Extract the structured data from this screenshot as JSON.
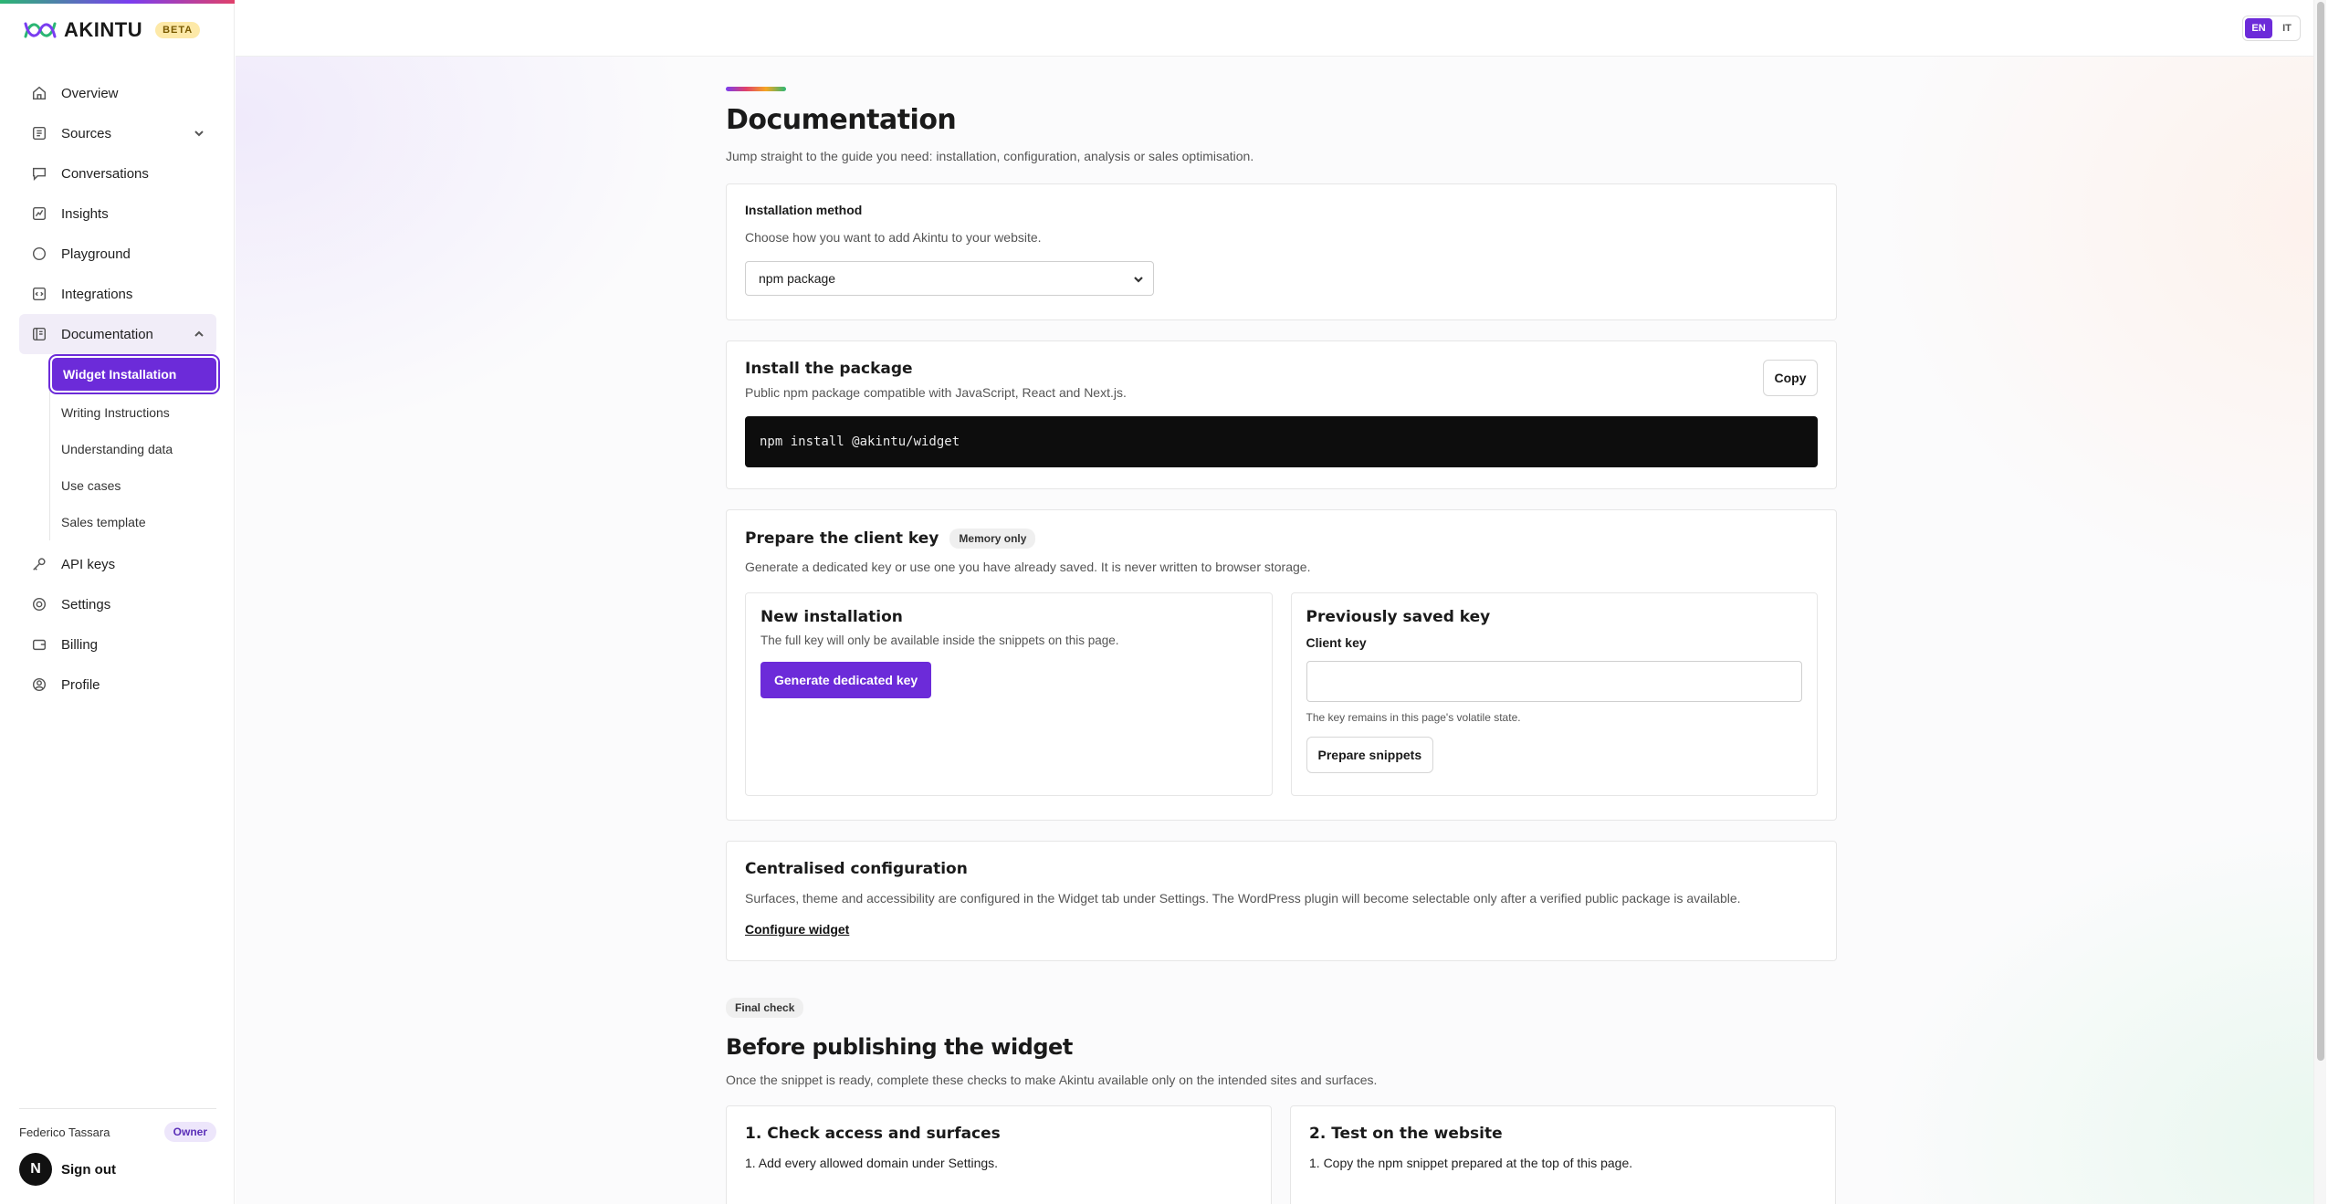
{
  "brand": {
    "name": "AKINTU",
    "badge": "BETA"
  },
  "nav": {
    "overview": "Overview",
    "sources": "Sources",
    "conversations": "Conversations",
    "insights": "Insights",
    "playground": "Playground",
    "integrations": "Integrations",
    "documentation": "Documentation",
    "docs_sub": [
      "Widget Installation",
      "Writing Instructions",
      "Understanding data",
      "Use cases",
      "Sales template"
    ],
    "api_keys": "API keys",
    "settings": "Settings",
    "billing": "Billing",
    "profile": "Profile"
  },
  "user": {
    "name": "Federico Tassara",
    "role": "Owner",
    "avatar_letter": "N",
    "signout": "Sign out"
  },
  "lang": {
    "en": "EN",
    "it": "IT",
    "active": "EN"
  },
  "page": {
    "title": "Documentation",
    "subtitle": "Jump straight to the guide you need: installation, configuration, analysis or sales optimisation."
  },
  "install_method": {
    "title": "Installation method",
    "desc": "Choose how you want to add Akintu to your website.",
    "selected": "npm package"
  },
  "install_package": {
    "title": "Install the package",
    "desc": "Public npm package compatible with JavaScript, React and Next.js.",
    "copy": "Copy",
    "command": "npm install @akintu/widget"
  },
  "client_key": {
    "title": "Prepare the client key",
    "badge": "Memory only",
    "desc": "Generate a dedicated key or use one you have already saved. It is never written to browser storage.",
    "new": {
      "title": "New installation",
      "desc": "The full key will only be available inside the snippets on this page.",
      "button": "Generate dedicated key"
    },
    "saved": {
      "title": "Previously saved key",
      "label": "Client key",
      "value": "",
      "hint": "The key remains in this page's volatile state.",
      "button": "Prepare snippets"
    }
  },
  "central_config": {
    "title": "Centralised configuration",
    "desc": "Surfaces, theme and accessibility are configured in the Widget tab under Settings. The WordPress plugin will become selectable only after a verified public package is available.",
    "link": "Configure widget"
  },
  "final": {
    "badge": "Final check",
    "title": "Before publishing the widget",
    "desc": "Once the snippet is ready, complete these checks to make Akintu available only on the intended sites and surfaces.",
    "card1": {
      "title": "1. Check access and surfaces",
      "item1": "1. Add every allowed domain under Settings."
    },
    "card2": {
      "title": "2. Test on the website",
      "item1": "1. Copy the npm snippet prepared at the top of this page."
    }
  }
}
